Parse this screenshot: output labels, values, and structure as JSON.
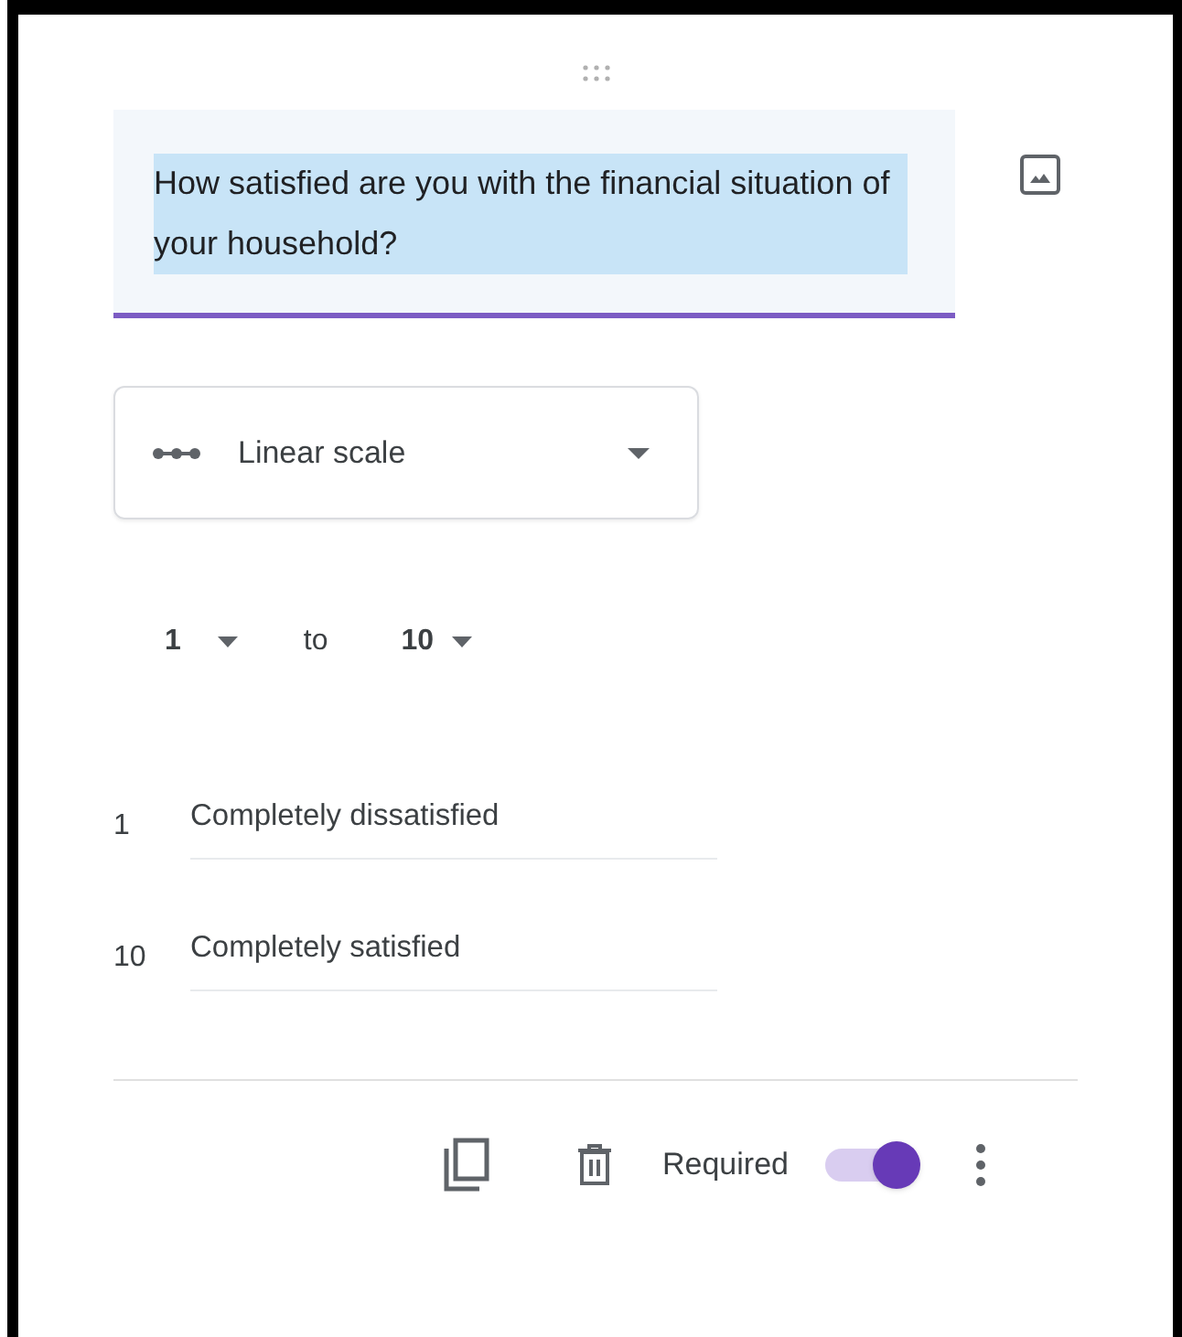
{
  "question": {
    "text": "How satisfied are you with the financial situation of your household?",
    "text_selected": true
  },
  "question_type": {
    "label": "Linear scale"
  },
  "scale": {
    "from": "1",
    "separator": "to",
    "to": "10"
  },
  "scale_labels": [
    {
      "number": "1",
      "text": "Completely dissatisfied"
    },
    {
      "number": "10",
      "text": "Completely satisfied"
    }
  ],
  "required": {
    "label": "Required",
    "on": true
  }
}
